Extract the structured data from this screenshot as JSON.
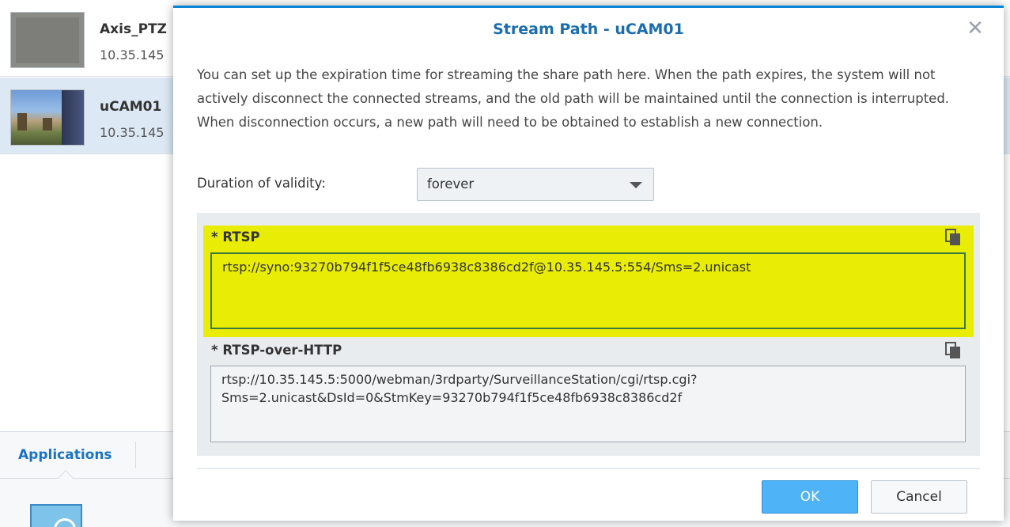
{
  "camera_list": [
    {
      "name": "Axis_PTZ",
      "ip": "10.35.145",
      "selected": false
    },
    {
      "name": "uCAM01",
      "ip": "10.35.145",
      "selected": true
    }
  ],
  "bottom_tabs": {
    "active": "Applications"
  },
  "dialog": {
    "title": "Stream Path - uCAM01",
    "description": "You can set up the expiration time for streaming the share path here. When the path expires, the system will not actively disconnect the connected streams, and the old path will be maintained until the connection is interrupted. When disconnection occurs, a new path will need to be obtained to establish a new connection.",
    "validity_label": "Duration of validity:",
    "validity_value": "forever",
    "paths": [
      {
        "label": "* RTSP",
        "value": "rtsp://syno:93270b794f1f5ce48fb6938c8386cd2f@10.35.145.5:554/Sms=2.unicast",
        "highlighted": true
      },
      {
        "label": "* RTSP-over-HTTP",
        "value": "rtsp://10.35.145.5:5000/webman/3rdparty/SurveillanceStation/cgi/rtsp.cgi?\nSms=2.unicast&DsId=0&StmKey=93270b794f1f5ce48fb6938c8386cd2f",
        "highlighted": false
      }
    ],
    "ok_label": "OK",
    "cancel_label": "Cancel"
  },
  "icons": {
    "close": "close-icon",
    "copy": "copy-icon",
    "dropdown": "chevron-down-icon"
  },
  "colors": {
    "accent": "#0a85d6",
    "highlight": "#e9ec04",
    "ok_button": "#4fb4f7",
    "title": "#1a6eaf"
  }
}
